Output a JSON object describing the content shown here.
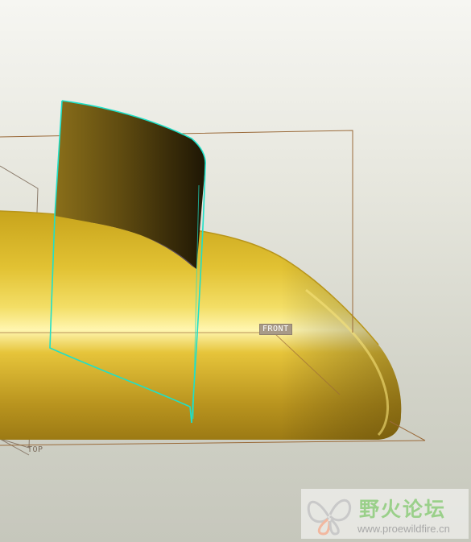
{
  "viewport": {
    "datums": {
      "front": "FRONT",
      "top": "TOP"
    },
    "colors": {
      "background_top": "#f6f6f2",
      "background_bottom": "#c6c7bc",
      "solid_body": "#c8a92a",
      "surface_highlight": "#00e5c8",
      "datum_plane": "#9a6a3a"
    }
  },
  "watermark": {
    "title": "野火论坛",
    "url": "www.proewildfire.cn",
    "icon": "butterfly-logo-icon"
  }
}
